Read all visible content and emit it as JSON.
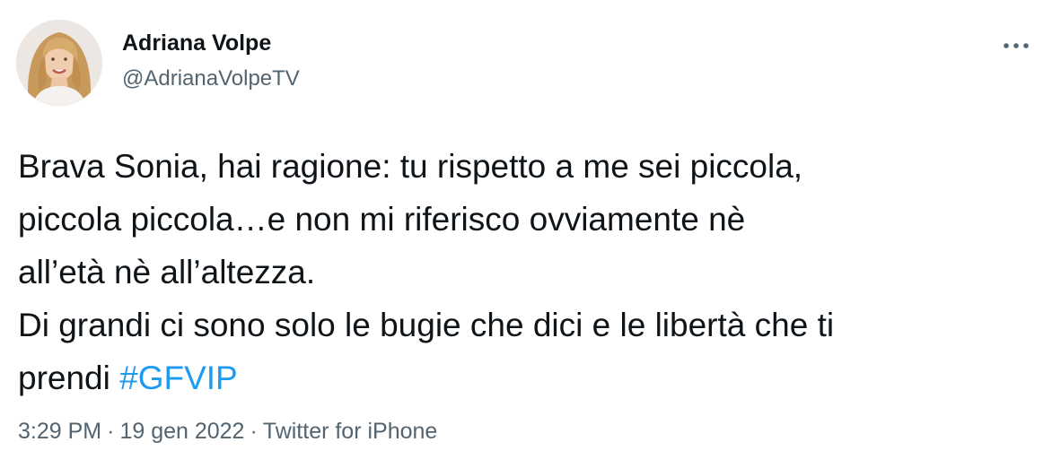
{
  "author": {
    "display_name": "Adriana Volpe",
    "handle": "@AdrianaVolpeTV"
  },
  "menu": {
    "icon": "more-horizontal-icon"
  },
  "tweet": {
    "lines": [
      "Brava Sonia, hai ragione: tu rispetto a me sei piccola,",
      "piccola piccola…e non mi riferisco ovviamente nè",
      "all’età nè all’altezza.",
      "Di grandi ci sono solo le bugie che dici e le libertà che ti"
    ],
    "last_line_prefix": "prendi ",
    "hashtag": "#GFVIP"
  },
  "meta": {
    "time": "3:29 PM",
    "separator": "·",
    "date": "19 gen 2022",
    "source": "Twitter for iPhone"
  },
  "colors": {
    "link": "#1d9bf0",
    "secondary_text": "#536471",
    "primary_text": "#0f1419"
  }
}
